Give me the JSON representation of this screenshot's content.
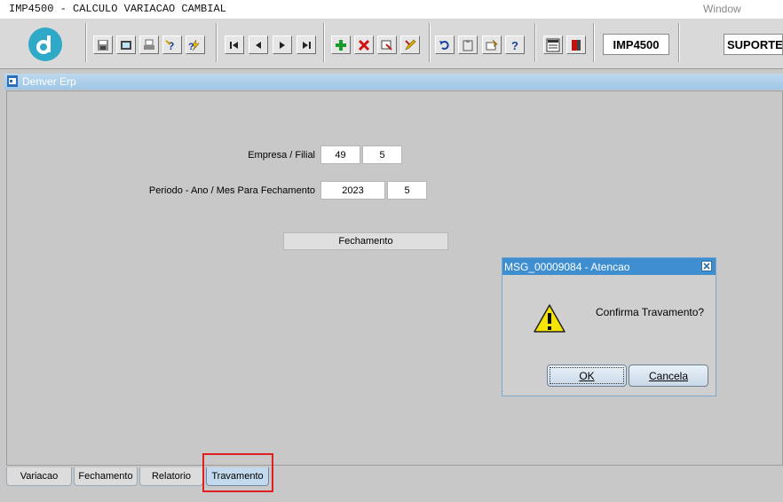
{
  "window": {
    "title": "IMP4500 - CALCULO VARIACAO CAMBIAL",
    "menu": "Window"
  },
  "toolbar": {
    "module_code": "IMP4500",
    "user": "SUPORTE("
  },
  "inner_window": {
    "title": "Denver Erp"
  },
  "form": {
    "empresa_label": "Empresa / Filial",
    "empresa": "49",
    "filial": "5",
    "periodo_label": "Periodo - Ano / Mes Para Fechamento",
    "ano": "2023",
    "mes": "5",
    "fechamento_button": "Fechamento"
  },
  "dialog": {
    "title": "MSG_00009084 - Atencao",
    "message": "Confirma Travamento?",
    "ok_label": "OK",
    "cancel_label": "Cancela"
  },
  "tabs": [
    {
      "label": "Variacao"
    },
    {
      "label": "Fechamento"
    },
    {
      "label": "Relatorio"
    },
    {
      "label": "Travamento"
    }
  ],
  "colors": {
    "highlight": "#e02020",
    "dialog_title": "#3f8fd0",
    "logo": "#2fa9c8"
  }
}
